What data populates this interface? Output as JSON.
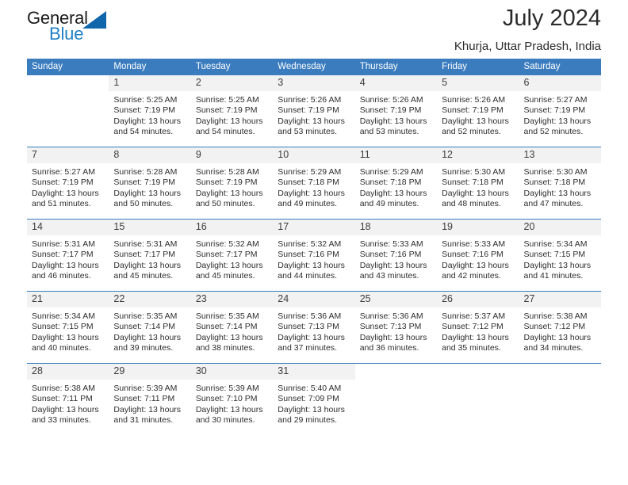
{
  "brand": {
    "name_part1": "General",
    "name_part2": "Blue",
    "triangle_color": "#1066ab",
    "blue_color": "#1f7fc4"
  },
  "header": {
    "title": "July 2024",
    "location": "Khurja, Uttar Pradesh, India"
  },
  "theme": {
    "header_bar_color": "#3a7cbe",
    "daynum_band_color": "#f2f2f2",
    "text_color": "#2e2e2e"
  },
  "weekdays": [
    "Sunday",
    "Monday",
    "Tuesday",
    "Wednesday",
    "Thursday",
    "Friday",
    "Saturday"
  ],
  "weeks": [
    [
      {
        "day": "",
        "sunrise": "",
        "sunset": "",
        "daylight1": "",
        "daylight2": ""
      },
      {
        "day": "1",
        "sunrise": "Sunrise: 5:25 AM",
        "sunset": "Sunset: 7:19 PM",
        "daylight1": "Daylight: 13 hours",
        "daylight2": "and 54 minutes."
      },
      {
        "day": "2",
        "sunrise": "Sunrise: 5:25 AM",
        "sunset": "Sunset: 7:19 PM",
        "daylight1": "Daylight: 13 hours",
        "daylight2": "and 54 minutes."
      },
      {
        "day": "3",
        "sunrise": "Sunrise: 5:26 AM",
        "sunset": "Sunset: 7:19 PM",
        "daylight1": "Daylight: 13 hours",
        "daylight2": "and 53 minutes."
      },
      {
        "day": "4",
        "sunrise": "Sunrise: 5:26 AM",
        "sunset": "Sunset: 7:19 PM",
        "daylight1": "Daylight: 13 hours",
        "daylight2": "and 53 minutes."
      },
      {
        "day": "5",
        "sunrise": "Sunrise: 5:26 AM",
        "sunset": "Sunset: 7:19 PM",
        "daylight1": "Daylight: 13 hours",
        "daylight2": "and 52 minutes."
      },
      {
        "day": "6",
        "sunrise": "Sunrise: 5:27 AM",
        "sunset": "Sunset: 7:19 PM",
        "daylight1": "Daylight: 13 hours",
        "daylight2": "and 52 minutes."
      }
    ],
    [
      {
        "day": "7",
        "sunrise": "Sunrise: 5:27 AM",
        "sunset": "Sunset: 7:19 PM",
        "daylight1": "Daylight: 13 hours",
        "daylight2": "and 51 minutes."
      },
      {
        "day": "8",
        "sunrise": "Sunrise: 5:28 AM",
        "sunset": "Sunset: 7:19 PM",
        "daylight1": "Daylight: 13 hours",
        "daylight2": "and 50 minutes."
      },
      {
        "day": "9",
        "sunrise": "Sunrise: 5:28 AM",
        "sunset": "Sunset: 7:19 PM",
        "daylight1": "Daylight: 13 hours",
        "daylight2": "and 50 minutes."
      },
      {
        "day": "10",
        "sunrise": "Sunrise: 5:29 AM",
        "sunset": "Sunset: 7:18 PM",
        "daylight1": "Daylight: 13 hours",
        "daylight2": "and 49 minutes."
      },
      {
        "day": "11",
        "sunrise": "Sunrise: 5:29 AM",
        "sunset": "Sunset: 7:18 PM",
        "daylight1": "Daylight: 13 hours",
        "daylight2": "and 49 minutes."
      },
      {
        "day": "12",
        "sunrise": "Sunrise: 5:30 AM",
        "sunset": "Sunset: 7:18 PM",
        "daylight1": "Daylight: 13 hours",
        "daylight2": "and 48 minutes."
      },
      {
        "day": "13",
        "sunrise": "Sunrise: 5:30 AM",
        "sunset": "Sunset: 7:18 PM",
        "daylight1": "Daylight: 13 hours",
        "daylight2": "and 47 minutes."
      }
    ],
    [
      {
        "day": "14",
        "sunrise": "Sunrise: 5:31 AM",
        "sunset": "Sunset: 7:17 PM",
        "daylight1": "Daylight: 13 hours",
        "daylight2": "and 46 minutes."
      },
      {
        "day": "15",
        "sunrise": "Sunrise: 5:31 AM",
        "sunset": "Sunset: 7:17 PM",
        "daylight1": "Daylight: 13 hours",
        "daylight2": "and 45 minutes."
      },
      {
        "day": "16",
        "sunrise": "Sunrise: 5:32 AM",
        "sunset": "Sunset: 7:17 PM",
        "daylight1": "Daylight: 13 hours",
        "daylight2": "and 45 minutes."
      },
      {
        "day": "17",
        "sunrise": "Sunrise: 5:32 AM",
        "sunset": "Sunset: 7:16 PM",
        "daylight1": "Daylight: 13 hours",
        "daylight2": "and 44 minutes."
      },
      {
        "day": "18",
        "sunrise": "Sunrise: 5:33 AM",
        "sunset": "Sunset: 7:16 PM",
        "daylight1": "Daylight: 13 hours",
        "daylight2": "and 43 minutes."
      },
      {
        "day": "19",
        "sunrise": "Sunrise: 5:33 AM",
        "sunset": "Sunset: 7:16 PM",
        "daylight1": "Daylight: 13 hours",
        "daylight2": "and 42 minutes."
      },
      {
        "day": "20",
        "sunrise": "Sunrise: 5:34 AM",
        "sunset": "Sunset: 7:15 PM",
        "daylight1": "Daylight: 13 hours",
        "daylight2": "and 41 minutes."
      }
    ],
    [
      {
        "day": "21",
        "sunrise": "Sunrise: 5:34 AM",
        "sunset": "Sunset: 7:15 PM",
        "daylight1": "Daylight: 13 hours",
        "daylight2": "and 40 minutes."
      },
      {
        "day": "22",
        "sunrise": "Sunrise: 5:35 AM",
        "sunset": "Sunset: 7:14 PM",
        "daylight1": "Daylight: 13 hours",
        "daylight2": "and 39 minutes."
      },
      {
        "day": "23",
        "sunrise": "Sunrise: 5:35 AM",
        "sunset": "Sunset: 7:14 PM",
        "daylight1": "Daylight: 13 hours",
        "daylight2": "and 38 minutes."
      },
      {
        "day": "24",
        "sunrise": "Sunrise: 5:36 AM",
        "sunset": "Sunset: 7:13 PM",
        "daylight1": "Daylight: 13 hours",
        "daylight2": "and 37 minutes."
      },
      {
        "day": "25",
        "sunrise": "Sunrise: 5:36 AM",
        "sunset": "Sunset: 7:13 PM",
        "daylight1": "Daylight: 13 hours",
        "daylight2": "and 36 minutes."
      },
      {
        "day": "26",
        "sunrise": "Sunrise: 5:37 AM",
        "sunset": "Sunset: 7:12 PM",
        "daylight1": "Daylight: 13 hours",
        "daylight2": "and 35 minutes."
      },
      {
        "day": "27",
        "sunrise": "Sunrise: 5:38 AM",
        "sunset": "Sunset: 7:12 PM",
        "daylight1": "Daylight: 13 hours",
        "daylight2": "and 34 minutes."
      }
    ],
    [
      {
        "day": "28",
        "sunrise": "Sunrise: 5:38 AM",
        "sunset": "Sunset: 7:11 PM",
        "daylight1": "Daylight: 13 hours",
        "daylight2": "and 33 minutes."
      },
      {
        "day": "29",
        "sunrise": "Sunrise: 5:39 AM",
        "sunset": "Sunset: 7:11 PM",
        "daylight1": "Daylight: 13 hours",
        "daylight2": "and 31 minutes."
      },
      {
        "day": "30",
        "sunrise": "Sunrise: 5:39 AM",
        "sunset": "Sunset: 7:10 PM",
        "daylight1": "Daylight: 13 hours",
        "daylight2": "and 30 minutes."
      },
      {
        "day": "31",
        "sunrise": "Sunrise: 5:40 AM",
        "sunset": "Sunset: 7:09 PM",
        "daylight1": "Daylight: 13 hours",
        "daylight2": "and 29 minutes."
      },
      {
        "day": "",
        "sunrise": "",
        "sunset": "",
        "daylight1": "",
        "daylight2": ""
      },
      {
        "day": "",
        "sunrise": "",
        "sunset": "",
        "daylight1": "",
        "daylight2": ""
      },
      {
        "day": "",
        "sunrise": "",
        "sunset": "",
        "daylight1": "",
        "daylight2": ""
      }
    ]
  ]
}
